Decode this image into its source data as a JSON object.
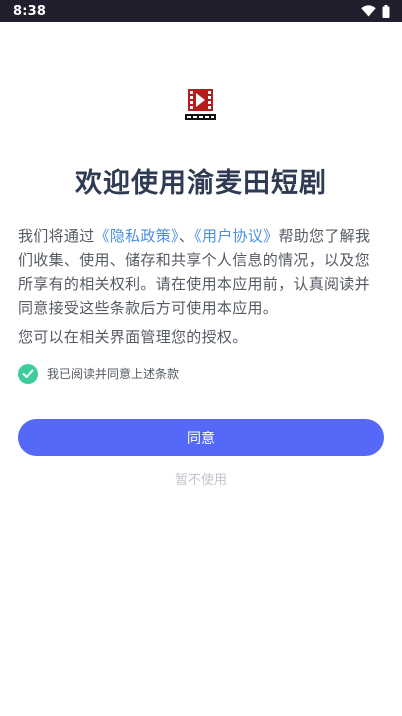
{
  "status_bar": {
    "time": "8:38"
  },
  "logo": {
    "alt_text": "渝麦田短剧"
  },
  "title": "欢迎使用渝麦田短剧",
  "intro": {
    "prefix": "我们将通过",
    "privacy_link": "《隐私政策》",
    "separator": "、",
    "terms_link": "《用户协议》",
    "suffix": "帮助您了解我们收集、使用、储存和共享个人信息的情况，以及您所享有的相关权利。请在使用本应用前，认真阅读并同意接受这些条款后方可使用本应用。"
  },
  "manage_note": "您可以在相关界面管理您的授权。",
  "agree_checkbox": {
    "label": "我已阅读并同意上述条款",
    "checked": true
  },
  "agree_button": "同意",
  "decline_button": "暂不使用",
  "colors": {
    "accent": "#5469f8",
    "link": "#4a8fe0",
    "check": "#3ecc9c",
    "title": "#2e3b52"
  }
}
